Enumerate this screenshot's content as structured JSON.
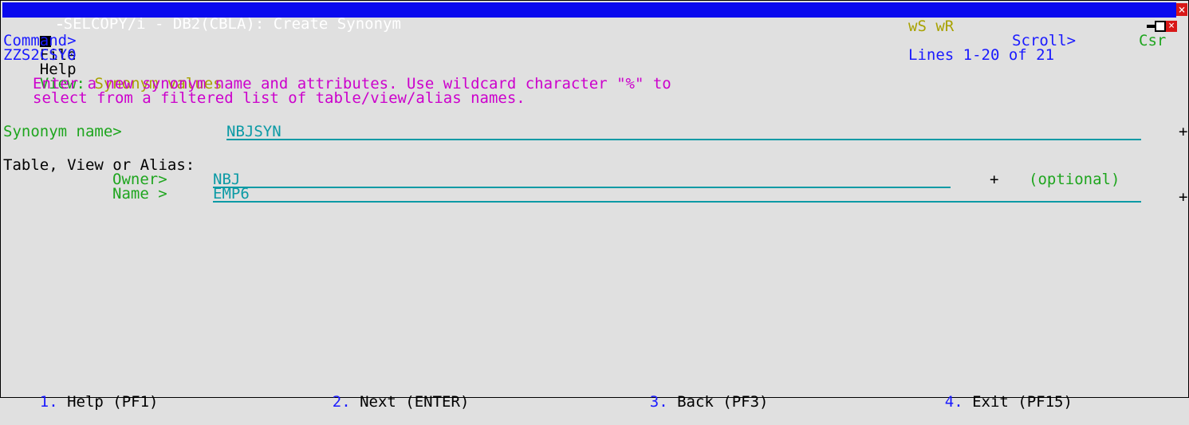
{
  "title_bar": {
    "text": "SELCOPY/i - DB2(CBLA): Create Synonym"
  },
  "menu": {
    "items": [
      "File",
      "Help"
    ],
    "indicators": "wS wR"
  },
  "command": {
    "label": "Command>",
    "value": ""
  },
  "scroll": {
    "label": "Scroll>",
    "value": "Csr"
  },
  "panel_id": "ZZS2CSY0",
  "lines": "Lines 1-20 of 21",
  "view": {
    "label": "View:",
    "value": "Synonym values"
  },
  "instructions": [
    "Enter a new synonym name and attributes. Use wildcard character \"%\" to",
    "select from a filtered list of table/view/alias names."
  ],
  "synonym": {
    "label": "Synonym name>",
    "value": "NBJSYN",
    "plus": "+"
  },
  "target": {
    "heading": "Table, View or Alias:",
    "owner_label": "Owner>",
    "owner_value": "NBJ",
    "owner_plus": "+",
    "owner_note": "(optional)",
    "name_label": "Name >",
    "name_value": "EMP6",
    "name_plus": "+"
  },
  "pf_keys": [
    {
      "num": "1.",
      "label": "Help (PF1)"
    },
    {
      "num": "2.",
      "label": "Next (ENTER)"
    },
    {
      "num": "3.",
      "label": "Back (PF3)"
    },
    {
      "num": "4.",
      "label": "Exit (PF15)"
    }
  ],
  "close_icon": "close-icon"
}
